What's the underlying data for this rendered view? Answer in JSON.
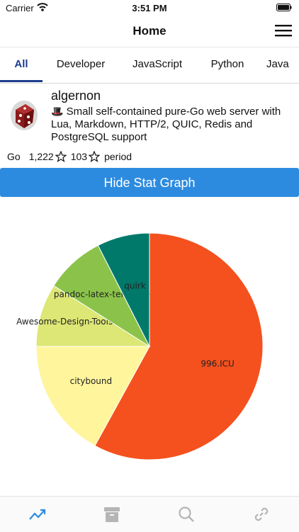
{
  "status_bar": {
    "carrier": "Carrier",
    "time": "3:51 PM"
  },
  "nav": {
    "title": "Home"
  },
  "tabs": [
    {
      "label": "All"
    },
    {
      "label": "Developer"
    },
    {
      "label": "JavaScript"
    },
    {
      "label": "Python"
    },
    {
      "label": "Java"
    }
  ],
  "repo": {
    "name": "algernon",
    "emoji": "🎩",
    "description": "Small self-contained pure-Go web server with Lua, Markdown, HTTP/2, QUIC, Redis and PostgreSQL support",
    "language": "Go",
    "stars": "1,222",
    "period_stars": "103",
    "period_label": "period"
  },
  "stat_button": {
    "label": "Hide Stat Graph"
  },
  "colors": {
    "accent": "#1c3c8c",
    "button": "#2d8bdf",
    "tab_bar_active": "#2d8bdf",
    "tab_bar_inactive": "#b5b5b5"
  },
  "chart_data": {
    "type": "pie",
    "title": "",
    "start_angle_deg": -90,
    "slices": [
      {
        "label": "996.ICU",
        "value": 58,
        "color": "#f4511e"
      },
      {
        "label": "citybound",
        "value": 17,
        "color": "#fff59d"
      },
      {
        "label": "Awesome-Design-Tools",
        "value": 9,
        "color": "#dce775"
      },
      {
        "label": "pandoc-latex-template",
        "value": 8.5,
        "color": "#8bc34a"
      },
      {
        "label": "quirk",
        "value": 7.5,
        "color": "#00796b"
      }
    ]
  },
  "tab_bar": {
    "items": [
      {
        "icon": "trending-icon",
        "active": true
      },
      {
        "icon": "archive-icon",
        "active": false
      },
      {
        "icon": "search-icon",
        "active": false
      },
      {
        "icon": "link-icon",
        "active": false
      }
    ]
  }
}
